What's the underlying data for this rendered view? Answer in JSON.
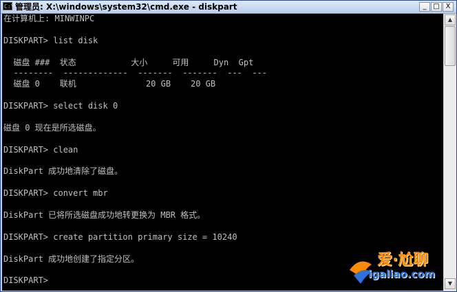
{
  "window": {
    "title": "管理员: X:\\windows\\system32\\cmd.exe - diskpart",
    "icon": "cmd-icon",
    "controls": {
      "minimize": "_",
      "maximize": "□",
      "close": "X"
    }
  },
  "console": {
    "lines": [
      "在计算机上: MINWINPC",
      "",
      "DISKPART> list disk",
      "",
      "  磁盘 ###  状态           大小     可用     Dyn  Gpt",
      "  --------  -------------  -------  -------  ---  ---",
      "  磁盘 0    联机              20 GB    20 GB",
      "",
      "DISKPART> select disk 0",
      "",
      "磁盘 0 现在是所选磁盘。",
      "",
      "DISKPART> clean",
      "",
      "DiskPart 成功地清除了磁盘。",
      "",
      "DISKPART> convert mbr",
      "",
      "DiskPart 已将所选磁盘成功地转更换为 MBR 格式。",
      "",
      "DISKPART> create partition primary size = 10240",
      "",
      "DiskPart 成功地创建了指定分区。",
      "",
      "DISKPART> "
    ]
  },
  "scrollbar": {
    "up_arrow": "▲",
    "down_arrow": "▼"
  },
  "watermark": {
    "line1": "爱·尬聊",
    "line2": "igaliao.com"
  }
}
